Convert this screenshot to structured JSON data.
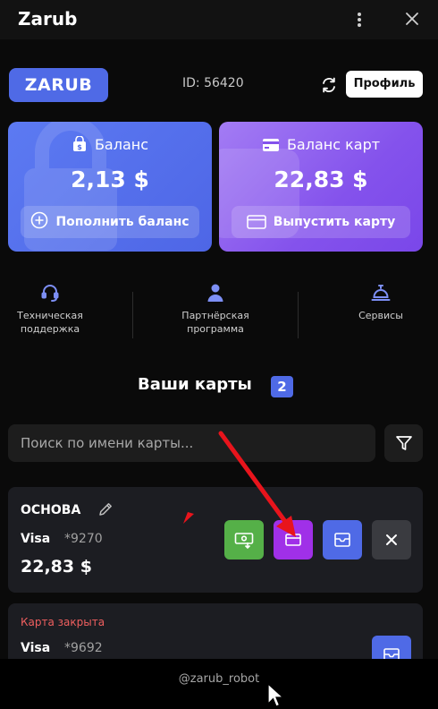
{
  "window": {
    "title": "Zarub"
  },
  "header": {
    "logo_text": "ZARUB",
    "user_id": "ID: 56420",
    "profile_label": "Профиль"
  },
  "balance_cards": [
    {
      "title": "Баланс",
      "amount": "2,13 $",
      "action": "Пополнить баланс",
      "color": "#4f6ae6"
    },
    {
      "title": "Баланс карт",
      "amount": "22,83 $",
      "action": "Выпустить карту",
      "color": "#8452ec"
    }
  ],
  "shortcuts": [
    {
      "label_line1": "Техническая",
      "label_line2": "поддержка",
      "icon": "headset-icon"
    },
    {
      "label_line1": "Партнёрская",
      "label_line2": "программа",
      "icon": "user-icon"
    },
    {
      "label_line1": "Сервисы",
      "label_line2": "",
      "icon": "service-bell-icon"
    }
  ],
  "cards_section": {
    "title": "Ваши карты",
    "count": "2",
    "search_placeholder": "Поиск по имени карты..."
  },
  "cards": [
    {
      "name": "ОСНОВА",
      "brand": "Visa",
      "number": "*9270",
      "balance": "22,83 $"
    },
    {
      "status": "Карта закрыта",
      "brand": "Visa",
      "number": "*9692"
    }
  ],
  "card_action_colors": {
    "topup": "#55b048",
    "details": "#a030e8",
    "history": "#4f6ae6",
    "close": "#3a3b40"
  },
  "footer": {
    "handle": "@zarub_robot"
  },
  "annotation_color": "#e8141c"
}
